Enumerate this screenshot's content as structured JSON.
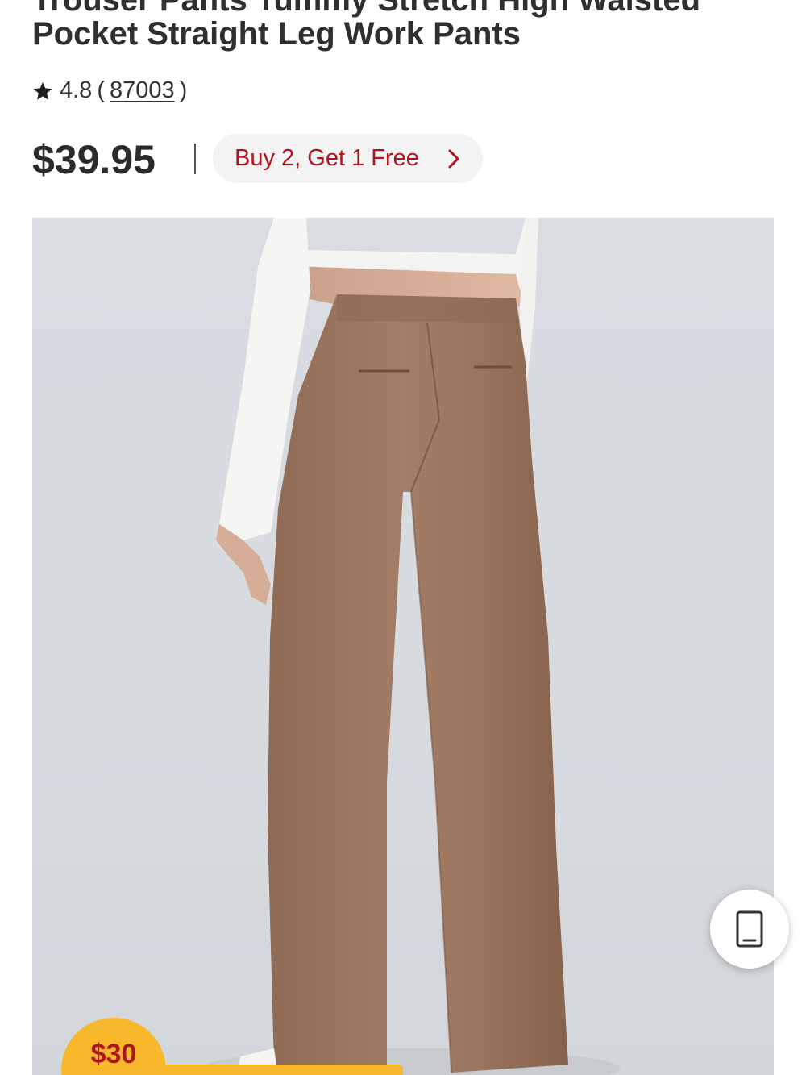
{
  "product": {
    "title_line_partial": "Trouser Pants Tummy Stretch High Waisted",
    "title_line": "Pocket Straight Leg Work Pants",
    "rating": "4.8",
    "review_count": "87003",
    "paren_open": "(",
    "paren_close": ")",
    "price": "$39.95",
    "promo_label": "Buy 2, Get 1 Free"
  },
  "floating": {
    "price_tag": "$30"
  },
  "icons": {
    "rating": "star-icon",
    "promo": "chevron-right-icon",
    "float": "phone-icon"
  },
  "colors": {
    "promo_text": "#b3131c",
    "pants": "#a07a63",
    "price_tag_bg": "#f8b82b"
  }
}
